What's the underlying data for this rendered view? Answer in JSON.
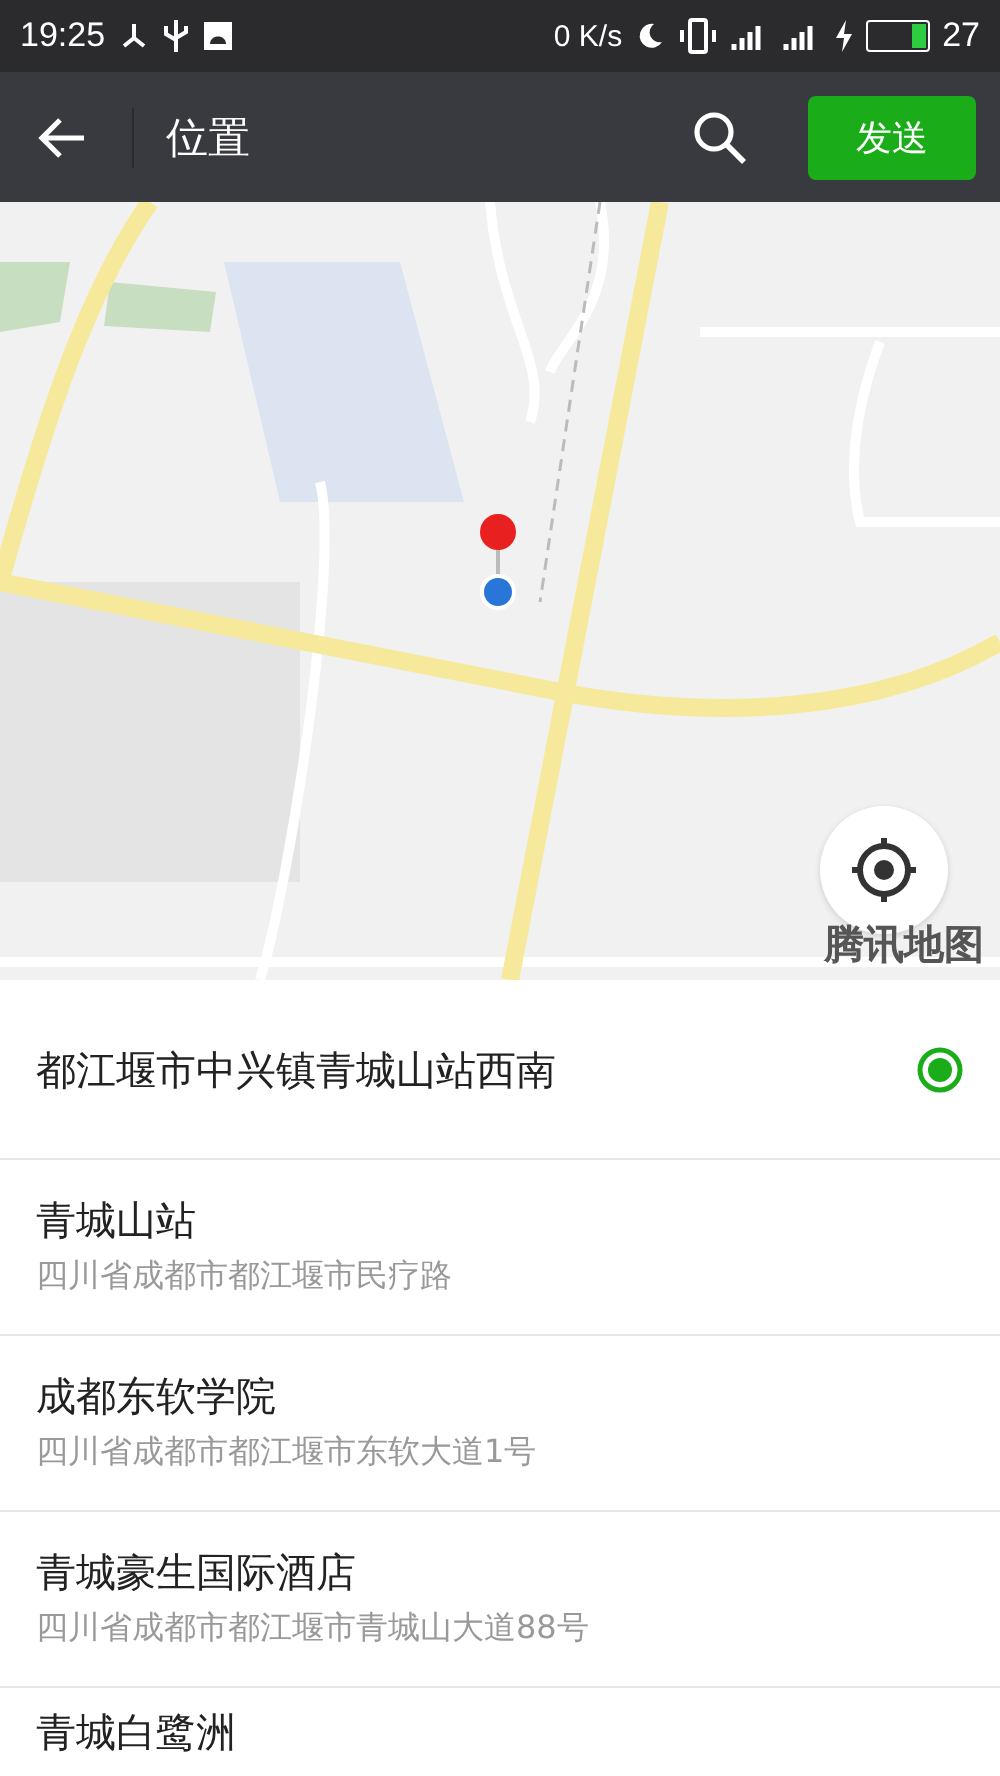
{
  "status_bar": {
    "time": "19:25",
    "net_speed": "0 K/s",
    "battery": "27"
  },
  "toolbar": {
    "title": "位置",
    "send_button": "发送"
  },
  "map": {
    "logo": "腾讯地图"
  },
  "places": [
    {
      "name": "都江堰市中兴镇青城山站西南",
      "selected": true
    },
    {
      "name": "青城山站",
      "address": "四川省成都市都江堰市民疗路",
      "selected": false
    },
    {
      "name": "成都东软学院",
      "address": "四川省成都市都江堰市东软大道1号",
      "selected": false
    },
    {
      "name": "青城豪生国际酒店",
      "address": "四川省成都市都江堰市青城山大道88号",
      "selected": false
    },
    {
      "name": "青城白鹭洲",
      "selected": false
    }
  ]
}
